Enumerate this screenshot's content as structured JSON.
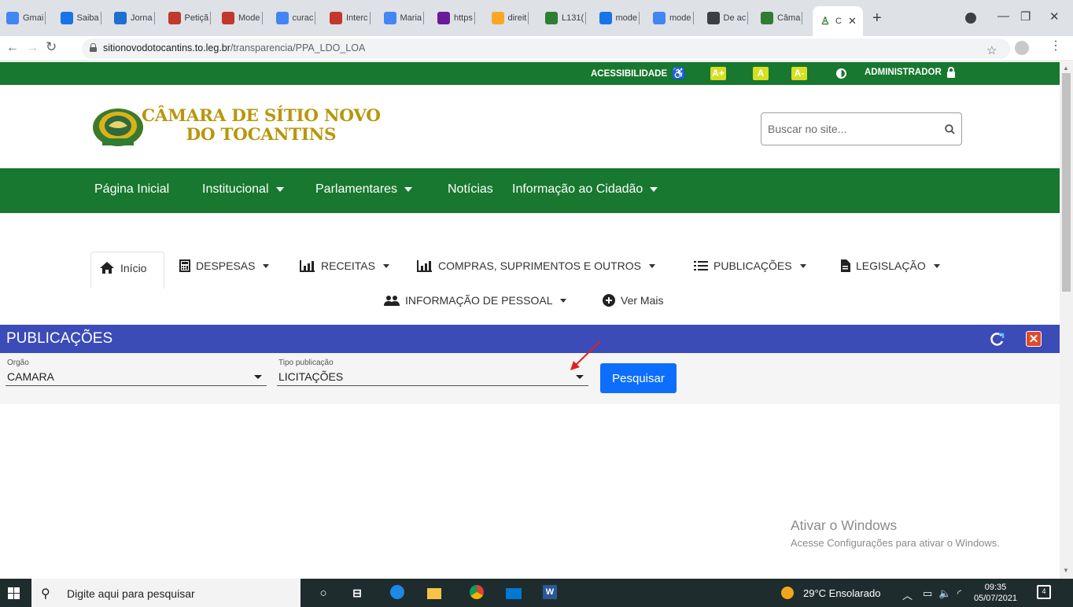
{
  "browser": {
    "tabs": [
      {
        "label": "Gmai",
        "icon": "google-icon",
        "color": "#4285f4"
      },
      {
        "label": "Saiba",
        "icon": "drive-icon",
        "color": "#1a73e8"
      },
      {
        "label": "Jorna",
        "icon": "news-icon",
        "color": "#1f6fd1"
      },
      {
        "label": "Petiçã",
        "icon": "petition-icon",
        "color": "#c0392b"
      },
      {
        "label": "Mode",
        "icon": "model-icon",
        "color": "#c0392b"
      },
      {
        "label": "curac",
        "icon": "google-icon",
        "color": "#4285f4"
      },
      {
        "label": "Interc",
        "icon": "migalhas-icon",
        "color": "#c0392b"
      },
      {
        "label": "Maria",
        "icon": "google-icon",
        "color": "#4285f4"
      },
      {
        "label": "https",
        "icon": "doc-icon",
        "color": "#6a1b9a"
      },
      {
        "label": "direit",
        "icon": "law-icon",
        "color": "#f9a825"
      },
      {
        "label": "L131(",
        "icon": "gov-icon",
        "color": "#2e7d32"
      },
      {
        "label": "mode",
        "icon": "drive-icon",
        "color": "#1a73e8"
      },
      {
        "label": "mode",
        "icon": "google-icon",
        "color": "#4285f4"
      },
      {
        "label": "De ac",
        "icon": "globe-icon",
        "color": "#3c4043"
      },
      {
        "label": "Câma",
        "icon": "camara-icon",
        "color": "#2e7d32"
      }
    ],
    "active_tab": {
      "label": "C",
      "icon": "camara-icon",
      "color": "#2e7d32"
    },
    "url_host": "sitionovodotocantins.to.leg.br",
    "url_path": "/transparencia/PPA_LDO_LOA"
  },
  "site": {
    "topbar": {
      "accessibility": "ACESSIBILIDADE",
      "font_plus": "A+",
      "font_normal": "A",
      "font_minus": "A-",
      "admin": "ADMINISTRADOR"
    },
    "logo": {
      "line1": "CÂMARA DE SÍTIO NOVO",
      "line2": "DO TOCANTINS"
    },
    "search_placeholder": "Buscar no site...",
    "main_nav": {
      "home": "Página Inicial",
      "institucional": "Institucional",
      "parlamentares": "Parlamentares",
      "noticias": "Notícias",
      "informacao": "Informação ao Cidadão"
    },
    "transparency_nav": {
      "inicio": "Início",
      "despesas": "DESPESAS",
      "receitas": "RECEITAS",
      "compras": "COMPRAS, SUPRIMENTOS E OUTROS",
      "publicacoes": "PUBLICAÇÕES",
      "legislacao": "LEGISLAÇÃO",
      "pessoal": "INFORMAÇÃO DE PESSOAL",
      "ver_mais": "Ver Mais"
    },
    "panel": {
      "title": "PUBLICAÇÕES",
      "orgao_label": "Orgão",
      "orgao_value": "CAMARA",
      "tipo_label": "Tipo publicação",
      "tipo_value": "LICITAÇÕES",
      "search_button": "Pesquisar"
    },
    "colors": {
      "green": "#18782f",
      "blue_header": "#3b4bb8",
      "button_blue": "#0d6efd",
      "logo_gold": "#b8960c"
    }
  },
  "watermark": {
    "line1": "Ativar o Windows",
    "line2": "Acesse Configurações para ativar o Windows."
  },
  "taskbar": {
    "search_text": "Digite aqui para pesquisar",
    "weather": "29°C  Ensolarado",
    "time": "09:35",
    "date": "05/07/2021",
    "notifications": "4"
  }
}
